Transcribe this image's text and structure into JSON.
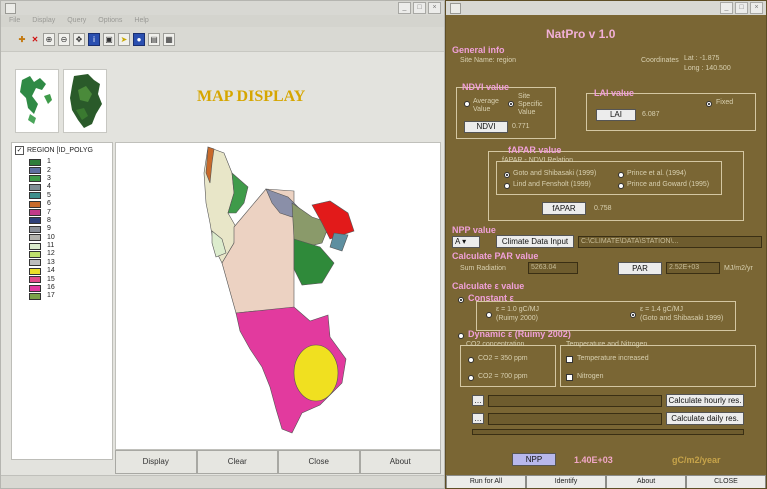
{
  "map_window": {
    "menus": [
      "File",
      "Display",
      "Query",
      "Options",
      "Help"
    ],
    "map_title": "MAP DISPLAY",
    "legend": {
      "layer_name": "REGION [ID_POLYG",
      "checked": "✓",
      "items": [
        {
          "label": "1",
          "color": "#2f7d3a"
        },
        {
          "label": "2",
          "color": "#5e6fa0"
        },
        {
          "label": "3",
          "color": "#3f9b4a"
        },
        {
          "label": "4",
          "color": "#7f8f95"
        },
        {
          "label": "5",
          "color": "#3e8f8c"
        },
        {
          "label": "6",
          "color": "#c86a2a"
        },
        {
          "label": "7",
          "color": "#c03a8a"
        },
        {
          "label": "8",
          "color": "#2d3f7a"
        },
        {
          "label": "9",
          "color": "#8a8f98"
        },
        {
          "label": "10",
          "color": "#b3b3ad"
        },
        {
          "label": "11",
          "color": "#dceccd"
        },
        {
          "label": "12",
          "color": "#bfe06c"
        },
        {
          "label": "13",
          "color": "#bdbdbd"
        },
        {
          "label": "14",
          "color": "#ecdd2a"
        },
        {
          "label": "15",
          "color": "#e04a8a"
        },
        {
          "label": "16",
          "color": "#e03aa0"
        },
        {
          "label": "17",
          "color": "#7aa24a"
        }
      ]
    },
    "buttons": [
      "Display",
      "Clear",
      "Close",
      "About"
    ]
  },
  "natpro": {
    "title": "NatPro v 1.0",
    "general_info": {
      "header": "General info",
      "site": "Site Name: region",
      "coord_label": "Coordinates",
      "lat": "Lat : -1.875",
      "long": "Long : 140.500"
    },
    "ndvi": {
      "header": "NDVI value",
      "opt_average": "Average",
      "opt_average2": "Value",
      "opt_site": "Site",
      "opt_site2": "Specific",
      "opt_site3": "Value",
      "button": "NDVI",
      "value": "0.771"
    },
    "lai": {
      "header": "LAI value",
      "opt": "Fixed",
      "button": "LAI",
      "value": "6.087"
    },
    "fapar": {
      "header": "fAPAR value",
      "relation": "fAPAR - NDVI Relation",
      "opt1": "Goto and Shibasaki (1999)",
      "opt2": "Prince et al. (1994)",
      "opt3": "Lind and Fensholt (1999)",
      "opt4": "Prince and Goward (1995)",
      "button": "fAPAR",
      "value": "0.758"
    },
    "npp": {
      "header": "NPP value",
      "select": "A",
      "button": "Climate Data Input",
      "info": "C:\\CLIMATE\\DATA\\STATION\\..."
    },
    "par": {
      "header": "Calculate PAR value",
      "solar_label": "Sum Radiation",
      "solar_value": "5263.04",
      "button": "PAR",
      "value": "2.52E+03",
      "unit": "MJ/m2/yr"
    },
    "epsilon": {
      "header": "Calculate ε value",
      "constant": "Constant ε",
      "c1": "ε = 1.0 gC/MJ",
      "c1b": "(Ruimy 2000)",
      "c2": "ε = 1.4 gC/MJ",
      "c2b": "(Goto and Shibasaki 1999)",
      "dynamic": "Dynamic ε (Ruimy 2002)",
      "co2_header": "CO2 concentration",
      "co2_1": "CO2 = 350 ppm",
      "co2_2": "CO2 = 700 ppm",
      "tn_header": "Temperature and Nitrogen",
      "tn_1": "Temperature increased",
      "tn_2": "Nitrogen",
      "hourly": "Calculate hourly res.",
      "daily": "Calculate daily res."
    },
    "result": {
      "button": "NPP",
      "value": "1.40E+03",
      "unit": "gC/m2/year"
    },
    "bottom": [
      "Run for All",
      "Identify",
      "About",
      "CLOSE"
    ]
  }
}
